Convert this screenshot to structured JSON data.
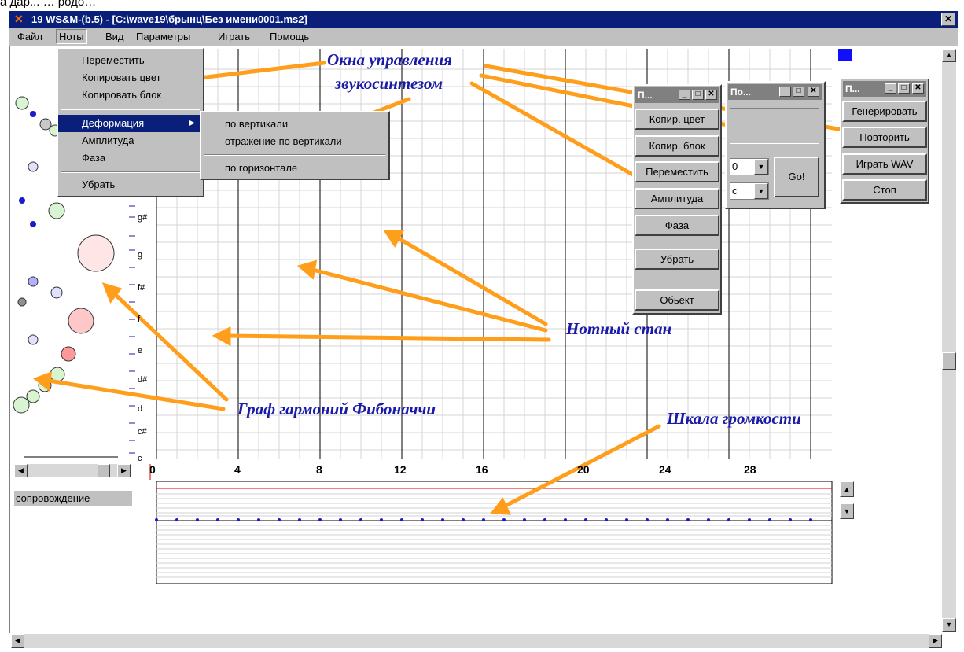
{
  "top_text": "а дар... … родо…",
  "window": {
    "title": "19 WS&M-(b.5) - [C:\\wave19\\брынц\\Без имени0001.ms2]",
    "close_glyph": "✕"
  },
  "menubar": [
    "Файл",
    "Ноты",
    "Вид",
    "Параметры",
    "Играть",
    "Помощь"
  ],
  "notes_menu": {
    "items": [
      "Переместить",
      "Копировать цвет",
      "Копировать блок",
      "Деформация",
      "Амплитуда",
      "Фаза",
      "Убрать"
    ],
    "submenu_arrow": "▶"
  },
  "deformation_submenu": [
    "по вертикали",
    "отражение по вертикали",
    "по горизонтале"
  ],
  "staff": {
    "note_labels": [
      "g#",
      "g",
      "f#",
      "f",
      "e",
      "d#",
      "d",
      "c#",
      "c"
    ],
    "x_ticks": [
      "0",
      "4",
      "8",
      "12",
      "16",
      "20",
      "24",
      "28"
    ]
  },
  "tool_window_1": {
    "title": "П...",
    "buttons": [
      "Копир. цвет",
      "Копир. блок",
      "Переместить",
      "Амплитуда",
      "Фаза",
      "Убрать",
      "Обьект"
    ]
  },
  "tool_window_2": {
    "title": "По...",
    "select1": "0",
    "select2": "c",
    "go": "Go!"
  },
  "tool_window_3": {
    "title": "П...",
    "buttons": [
      "Генерировать",
      "Повторить",
      "Играть WAV",
      "Стоп"
    ]
  },
  "track_label": "сопровождение",
  "annotations": {
    "synth_line1": "Окна управления",
    "synth_line2": "звукосинтезом",
    "staff": "Нотный стан",
    "fibonacci": "Граф гармоний Фибоначчи",
    "volume": "Шкала громкости"
  },
  "colors": {
    "titlebar": "#0a1f7a",
    "annotation_arrow": "#ff9e1b",
    "annotation_text": "#1a1aa8",
    "note_dot": "#1a1ad0"
  }
}
